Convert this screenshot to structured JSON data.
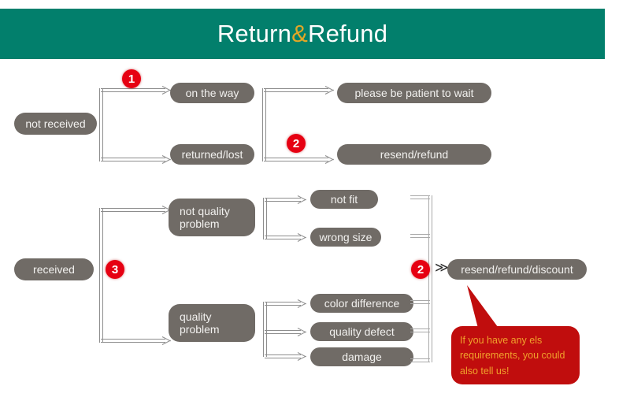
{
  "header": {
    "title_before": "Return",
    "amp": "&",
    "title_after": "Refund",
    "banner_color": "#027f6c",
    "amp_color": "#e2a726",
    "text_color": "#ffffff"
  },
  "palette": {
    "pill_fill": "#706b66",
    "pill_text": "#f2f1ef",
    "badge_fill": "#e60012",
    "badge_text": "#ffffff",
    "connector": "#a9a9a9",
    "callout_fill": "#c00d0d",
    "callout_text": "#f0a22c",
    "background": "#ffffff"
  },
  "nodes": {
    "not_received": "not received",
    "on_the_way": "on the way",
    "returned_lost": "returned/lost",
    "please_wait": "please be patient to wait",
    "resend_refund": "resend/refund",
    "received": "received",
    "not_quality_problem": "not quality\nproblem",
    "quality_problem": "quality\nproblem",
    "not_fit": "not fit",
    "wrong_size": "wrong size",
    "color_difference": "color difference",
    "quality_defect": "quality defect",
    "damage": "damage",
    "resend_refund_discount": "resend/refund/discount"
  },
  "badges": {
    "step1": "1",
    "step2_top": "2",
    "step2_bottom": "2",
    "step3": "3"
  },
  "chevron": "≫",
  "callout": {
    "text": "If you have any els\nrequirements, you could\nalso tell us!"
  }
}
